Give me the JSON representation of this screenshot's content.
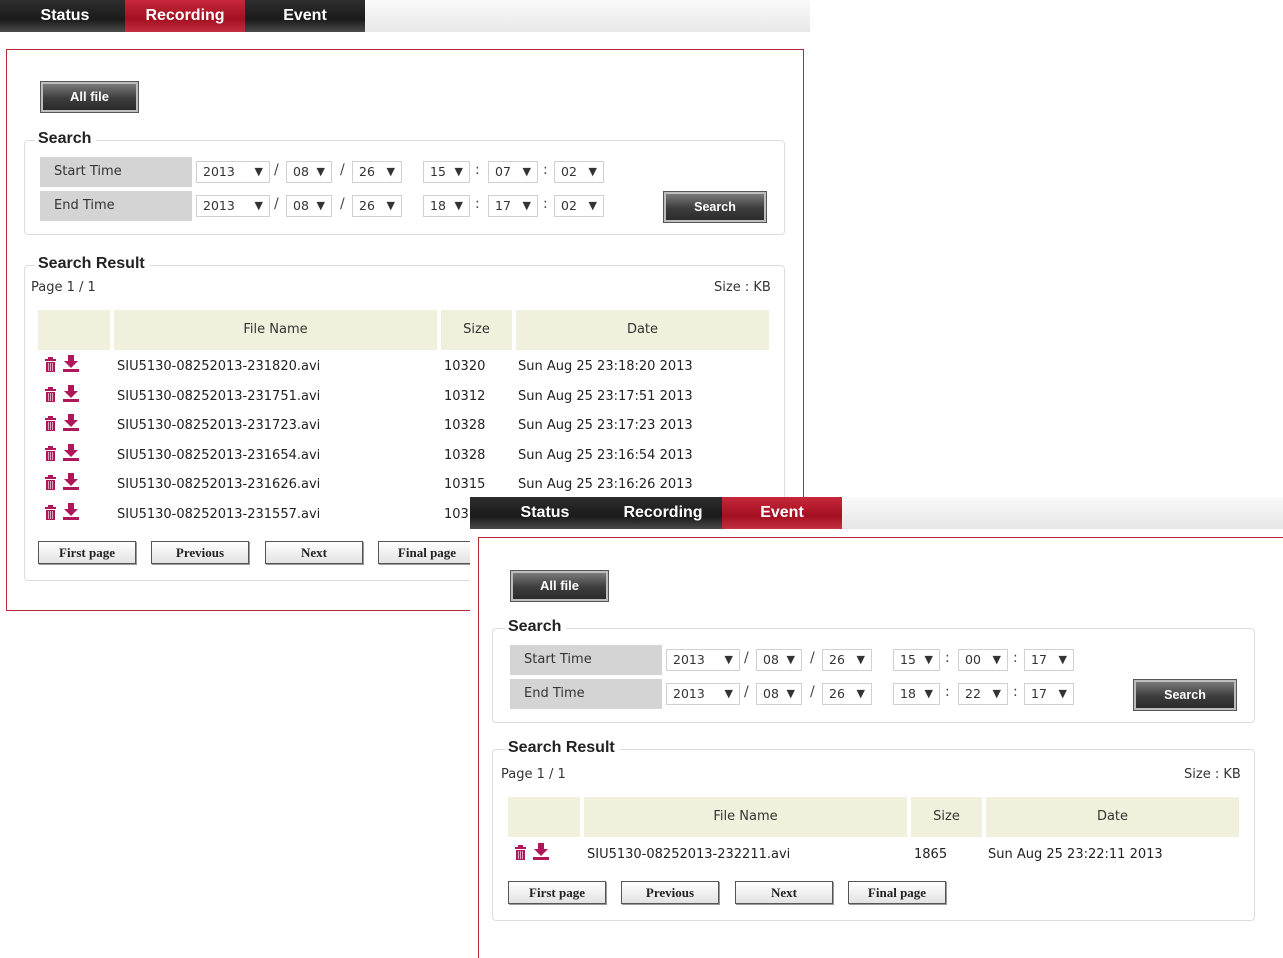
{
  "colors": {
    "accent": "#a91a2b",
    "dark_tab": "#1e1e1e",
    "header_bg": "#f1f0dc",
    "label_bg": "#d4d4d4",
    "icon": "#b0175a"
  },
  "recording_panel": {
    "tabs": [
      {
        "label": "Status",
        "active": false
      },
      {
        "label": "Recording",
        "active": true
      },
      {
        "label": "Event",
        "active": false
      }
    ],
    "all_file_label": "All file",
    "search": {
      "legend": "Search",
      "start_label": "Start Time",
      "end_label": "End Time",
      "start": {
        "year": "2013",
        "month": "08",
        "day": "26",
        "hour": "15",
        "minute": "07",
        "second": "02"
      },
      "end": {
        "year": "2013",
        "month": "08",
        "day": "26",
        "hour": "18",
        "minute": "17",
        "second": "02"
      },
      "date_sep": "/",
      "time_sep": ":",
      "button": "Search"
    },
    "result": {
      "legend": "Search Result",
      "page": "Page 1 / 1",
      "size_unit": "Size : KB",
      "headers": {
        "file": "File Name",
        "size": "Size",
        "date": "Date"
      },
      "rows": [
        {
          "file": "SIU5130-08252013-231820.avi",
          "size": "10320",
          "date": "Sun Aug 25 23:18:20 2013"
        },
        {
          "file": "SIU5130-08252013-231751.avi",
          "size": "10312",
          "date": "Sun Aug 25 23:17:51 2013"
        },
        {
          "file": "SIU5130-08252013-231723.avi",
          "size": "10328",
          "date": "Sun Aug 25 23:17:23 2013"
        },
        {
          "file": "SIU5130-08252013-231654.avi",
          "size": "10328",
          "date": "Sun Aug 25 23:16:54 2013"
        },
        {
          "file": "SIU5130-08252013-231626.avi",
          "size": "10315",
          "date": "Sun Aug 25 23:16:26 2013"
        },
        {
          "file": "SIU5130-08252013-231557.avi",
          "size": "103",
          "date": ""
        }
      ]
    },
    "pager": {
      "first": "First page",
      "previous": "Previous",
      "next": "Next",
      "final": "Final page"
    }
  },
  "event_panel": {
    "tabs": [
      {
        "label": "Status",
        "active": false
      },
      {
        "label": "Recording",
        "active": false
      },
      {
        "label": "Event",
        "active": true
      }
    ],
    "all_file_label": "All file",
    "search": {
      "legend": "Search",
      "start_label": "Start Time",
      "end_label": "End Time",
      "start": {
        "year": "2013",
        "month": "08",
        "day": "26",
        "hour": "15",
        "minute": "00",
        "second": "17"
      },
      "end": {
        "year": "2013",
        "month": "08",
        "day": "26",
        "hour": "18",
        "minute": "22",
        "second": "17"
      },
      "date_sep": "/",
      "time_sep": ":",
      "button": "Search"
    },
    "result": {
      "legend": "Search Result",
      "page": "Page 1 / 1",
      "size_unit": "Size : KB",
      "headers": {
        "file": "File Name",
        "size": "Size",
        "date": "Date"
      },
      "rows": [
        {
          "file": "SIU5130-08252013-232211.avi",
          "size": "1865",
          "date": "Sun Aug 25 23:22:11 2013"
        }
      ]
    },
    "pager": {
      "first": "First page",
      "previous": "Previous",
      "next": "Next",
      "final": "Final page"
    }
  }
}
